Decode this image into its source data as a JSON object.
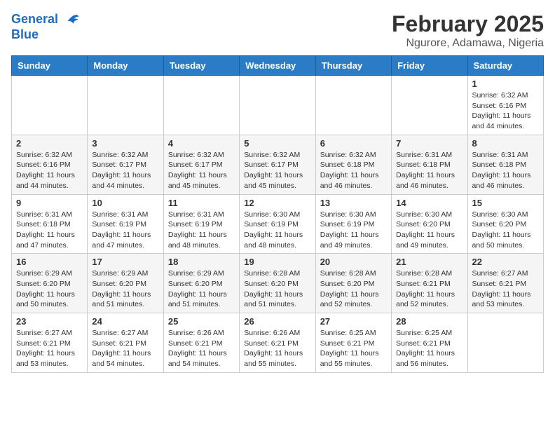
{
  "logo": {
    "line1": "General",
    "line2": "Blue"
  },
  "title": "February 2025",
  "location": "Ngurore, Adamawa, Nigeria",
  "weekdays": [
    "Sunday",
    "Monday",
    "Tuesday",
    "Wednesday",
    "Thursday",
    "Friday",
    "Saturday"
  ],
  "weeks": [
    [
      {
        "day": "",
        "info": ""
      },
      {
        "day": "",
        "info": ""
      },
      {
        "day": "",
        "info": ""
      },
      {
        "day": "",
        "info": ""
      },
      {
        "day": "",
        "info": ""
      },
      {
        "day": "",
        "info": ""
      },
      {
        "day": "1",
        "info": "Sunrise: 6:32 AM\nSunset: 6:16 PM\nDaylight: 11 hours\nand 44 minutes."
      }
    ],
    [
      {
        "day": "2",
        "info": "Sunrise: 6:32 AM\nSunset: 6:16 PM\nDaylight: 11 hours\nand 44 minutes."
      },
      {
        "day": "3",
        "info": "Sunrise: 6:32 AM\nSunset: 6:17 PM\nDaylight: 11 hours\nand 44 minutes."
      },
      {
        "day": "4",
        "info": "Sunrise: 6:32 AM\nSunset: 6:17 PM\nDaylight: 11 hours\nand 45 minutes."
      },
      {
        "day": "5",
        "info": "Sunrise: 6:32 AM\nSunset: 6:17 PM\nDaylight: 11 hours\nand 45 minutes."
      },
      {
        "day": "6",
        "info": "Sunrise: 6:32 AM\nSunset: 6:18 PM\nDaylight: 11 hours\nand 46 minutes."
      },
      {
        "day": "7",
        "info": "Sunrise: 6:31 AM\nSunset: 6:18 PM\nDaylight: 11 hours\nand 46 minutes."
      },
      {
        "day": "8",
        "info": "Sunrise: 6:31 AM\nSunset: 6:18 PM\nDaylight: 11 hours\nand 46 minutes."
      }
    ],
    [
      {
        "day": "9",
        "info": "Sunrise: 6:31 AM\nSunset: 6:18 PM\nDaylight: 11 hours\nand 47 minutes."
      },
      {
        "day": "10",
        "info": "Sunrise: 6:31 AM\nSunset: 6:19 PM\nDaylight: 11 hours\nand 47 minutes."
      },
      {
        "day": "11",
        "info": "Sunrise: 6:31 AM\nSunset: 6:19 PM\nDaylight: 11 hours\nand 48 minutes."
      },
      {
        "day": "12",
        "info": "Sunrise: 6:30 AM\nSunset: 6:19 PM\nDaylight: 11 hours\nand 48 minutes."
      },
      {
        "day": "13",
        "info": "Sunrise: 6:30 AM\nSunset: 6:19 PM\nDaylight: 11 hours\nand 49 minutes."
      },
      {
        "day": "14",
        "info": "Sunrise: 6:30 AM\nSunset: 6:20 PM\nDaylight: 11 hours\nand 49 minutes."
      },
      {
        "day": "15",
        "info": "Sunrise: 6:30 AM\nSunset: 6:20 PM\nDaylight: 11 hours\nand 50 minutes."
      }
    ],
    [
      {
        "day": "16",
        "info": "Sunrise: 6:29 AM\nSunset: 6:20 PM\nDaylight: 11 hours\nand 50 minutes."
      },
      {
        "day": "17",
        "info": "Sunrise: 6:29 AM\nSunset: 6:20 PM\nDaylight: 11 hours\nand 51 minutes."
      },
      {
        "day": "18",
        "info": "Sunrise: 6:29 AM\nSunset: 6:20 PM\nDaylight: 11 hours\nand 51 minutes."
      },
      {
        "day": "19",
        "info": "Sunrise: 6:28 AM\nSunset: 6:20 PM\nDaylight: 11 hours\nand 51 minutes."
      },
      {
        "day": "20",
        "info": "Sunrise: 6:28 AM\nSunset: 6:20 PM\nDaylight: 11 hours\nand 52 minutes."
      },
      {
        "day": "21",
        "info": "Sunrise: 6:28 AM\nSunset: 6:21 PM\nDaylight: 11 hours\nand 52 minutes."
      },
      {
        "day": "22",
        "info": "Sunrise: 6:27 AM\nSunset: 6:21 PM\nDaylight: 11 hours\nand 53 minutes."
      }
    ],
    [
      {
        "day": "23",
        "info": "Sunrise: 6:27 AM\nSunset: 6:21 PM\nDaylight: 11 hours\nand 53 minutes."
      },
      {
        "day": "24",
        "info": "Sunrise: 6:27 AM\nSunset: 6:21 PM\nDaylight: 11 hours\nand 54 minutes."
      },
      {
        "day": "25",
        "info": "Sunrise: 6:26 AM\nSunset: 6:21 PM\nDaylight: 11 hours\nand 54 minutes."
      },
      {
        "day": "26",
        "info": "Sunrise: 6:26 AM\nSunset: 6:21 PM\nDaylight: 11 hours\nand 55 minutes."
      },
      {
        "day": "27",
        "info": "Sunrise: 6:25 AM\nSunset: 6:21 PM\nDaylight: 11 hours\nand 55 minutes."
      },
      {
        "day": "28",
        "info": "Sunrise: 6:25 AM\nSunset: 6:21 PM\nDaylight: 11 hours\nand 56 minutes."
      },
      {
        "day": "",
        "info": ""
      }
    ]
  ]
}
